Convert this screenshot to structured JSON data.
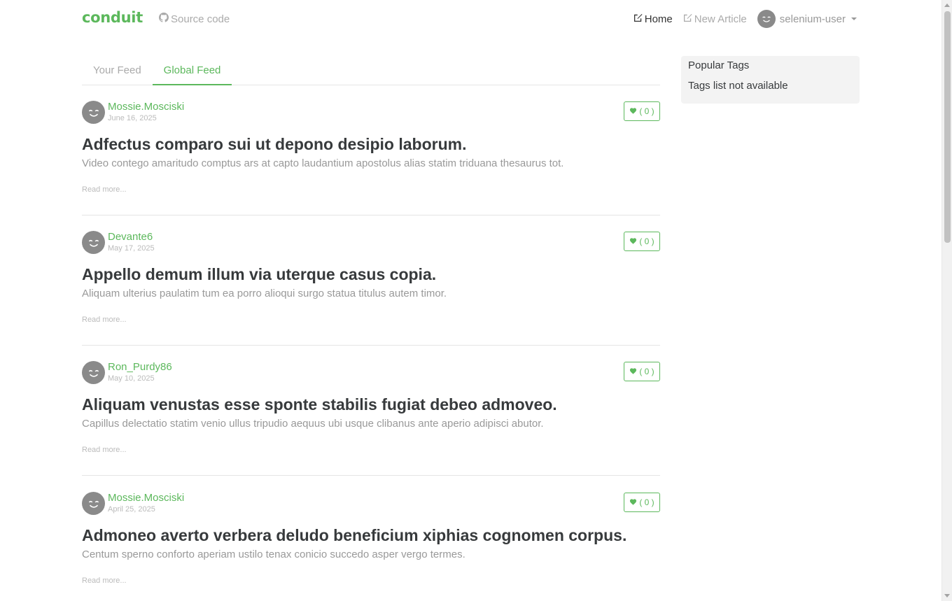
{
  "nav": {
    "brand": "conduit",
    "source_code": "Source code",
    "home": "Home",
    "new_article": "New Article",
    "username": "selenium-user"
  },
  "tabs": [
    "Your Feed",
    "Global Feed"
  ],
  "articles": [
    {
      "author": "Mossie.Mosciski",
      "date": "June 16, 2025",
      "favorites": "( 0 )",
      "title": "Adfectus comparo sui ut depono desipio laborum.",
      "description": "Video contego amaritudo comptus ars at capto laudantium apostolus alias statim triduana thesaurus tot.",
      "read_more": "Read more..."
    },
    {
      "author": "Devante6",
      "date": "May 17, 2025",
      "favorites": "( 0 )",
      "title": "Appello demum illum via uterque casus copia.",
      "description": "Aliquam ulterius paulatim tum ea porro alioqui surgo statua titulus autem timor.",
      "read_more": "Read more..."
    },
    {
      "author": "Ron_Purdy86",
      "date": "May 10, 2025",
      "favorites": "( 0 )",
      "title": "Aliquam venustas esse sponte stabilis fugiat debeo admoveo.",
      "description": "Capillus delectatio statim venio ullus tripudio aequus ubi usque clibanus ante aperio adipisci abutor.",
      "read_more": "Read more..."
    },
    {
      "author": "Mossie.Mosciski",
      "date": "April 25, 2025",
      "favorites": "( 0 )",
      "title": "Admoneo averto verbera deludo beneficium xiphias cognomen corpus.",
      "description": "Centum sperno conforto aperiam ustilo tenax conicio succedo asper vergo termes.",
      "read_more": "Read more..."
    }
  ],
  "sidebar": {
    "title": "Popular Tags",
    "empty": "Tags list not available"
  },
  "colors": {
    "brand": "#5cb85c",
    "muted": "#aaaaaa"
  },
  "icons": [
    "github-icon",
    "edit-icon",
    "heart-icon",
    "avatar-smiley-icon"
  ]
}
